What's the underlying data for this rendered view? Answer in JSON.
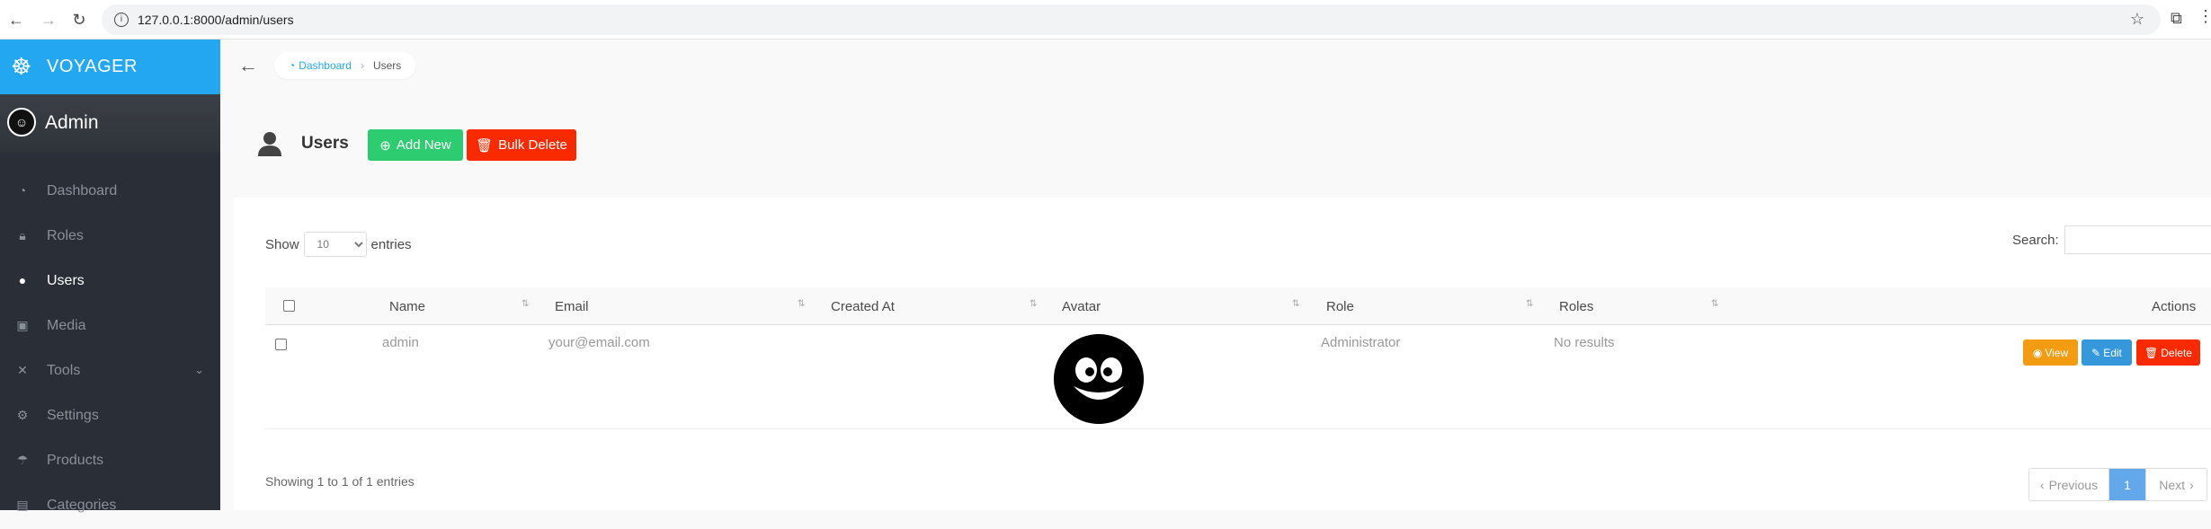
{
  "browser": {
    "url": "127.0.0.1:8000/admin/users"
  },
  "sidebar": {
    "brand": "VOYAGER",
    "profile_name": "Admin",
    "items": [
      {
        "label": "Dashboard",
        "icon": "dashboard-icon"
      },
      {
        "label": "Roles",
        "icon": "lock-icon"
      },
      {
        "label": "Users",
        "icon": "user-icon",
        "active": true
      },
      {
        "label": "Media",
        "icon": "images-icon"
      },
      {
        "label": "Tools",
        "icon": "tools-icon",
        "has_submenu": true
      },
      {
        "label": "Settings",
        "icon": "gear-icon"
      },
      {
        "label": "Products",
        "icon": "umbrella-icon"
      },
      {
        "label": "Categories",
        "icon": "document-icon"
      }
    ]
  },
  "breadcrumb": {
    "home": "Dashboard",
    "current": "Users"
  },
  "header": {
    "title": "Users",
    "add_label": "Add New",
    "bulk_delete_label": "Bulk Delete"
  },
  "table_controls": {
    "show_label": "Show",
    "entries_label": "entries",
    "page_size": "10",
    "search_label": "Search:"
  },
  "table": {
    "columns": [
      "Name",
      "Email",
      "Created At",
      "Avatar",
      "Role",
      "Roles",
      "Actions"
    ],
    "rows": [
      {
        "name": "admin",
        "email": "your@email.com",
        "created_at": "",
        "role": "Administrator",
        "roles": "No results"
      }
    ],
    "actions": {
      "view": "View",
      "edit": "Edit",
      "delete": "Delete"
    }
  },
  "footer": {
    "info": "Showing 1 to 1 of 1 entries",
    "prev": "Previous",
    "page": "1",
    "next": "Next"
  },
  "colors": {
    "brand": "#22a7f0",
    "sidebar": "#2a2e36",
    "add": "#2ecc71",
    "danger": "#fa2a00",
    "view": "#f39c12",
    "edit": "#3498db",
    "pagination_active": "#62a8ea"
  }
}
